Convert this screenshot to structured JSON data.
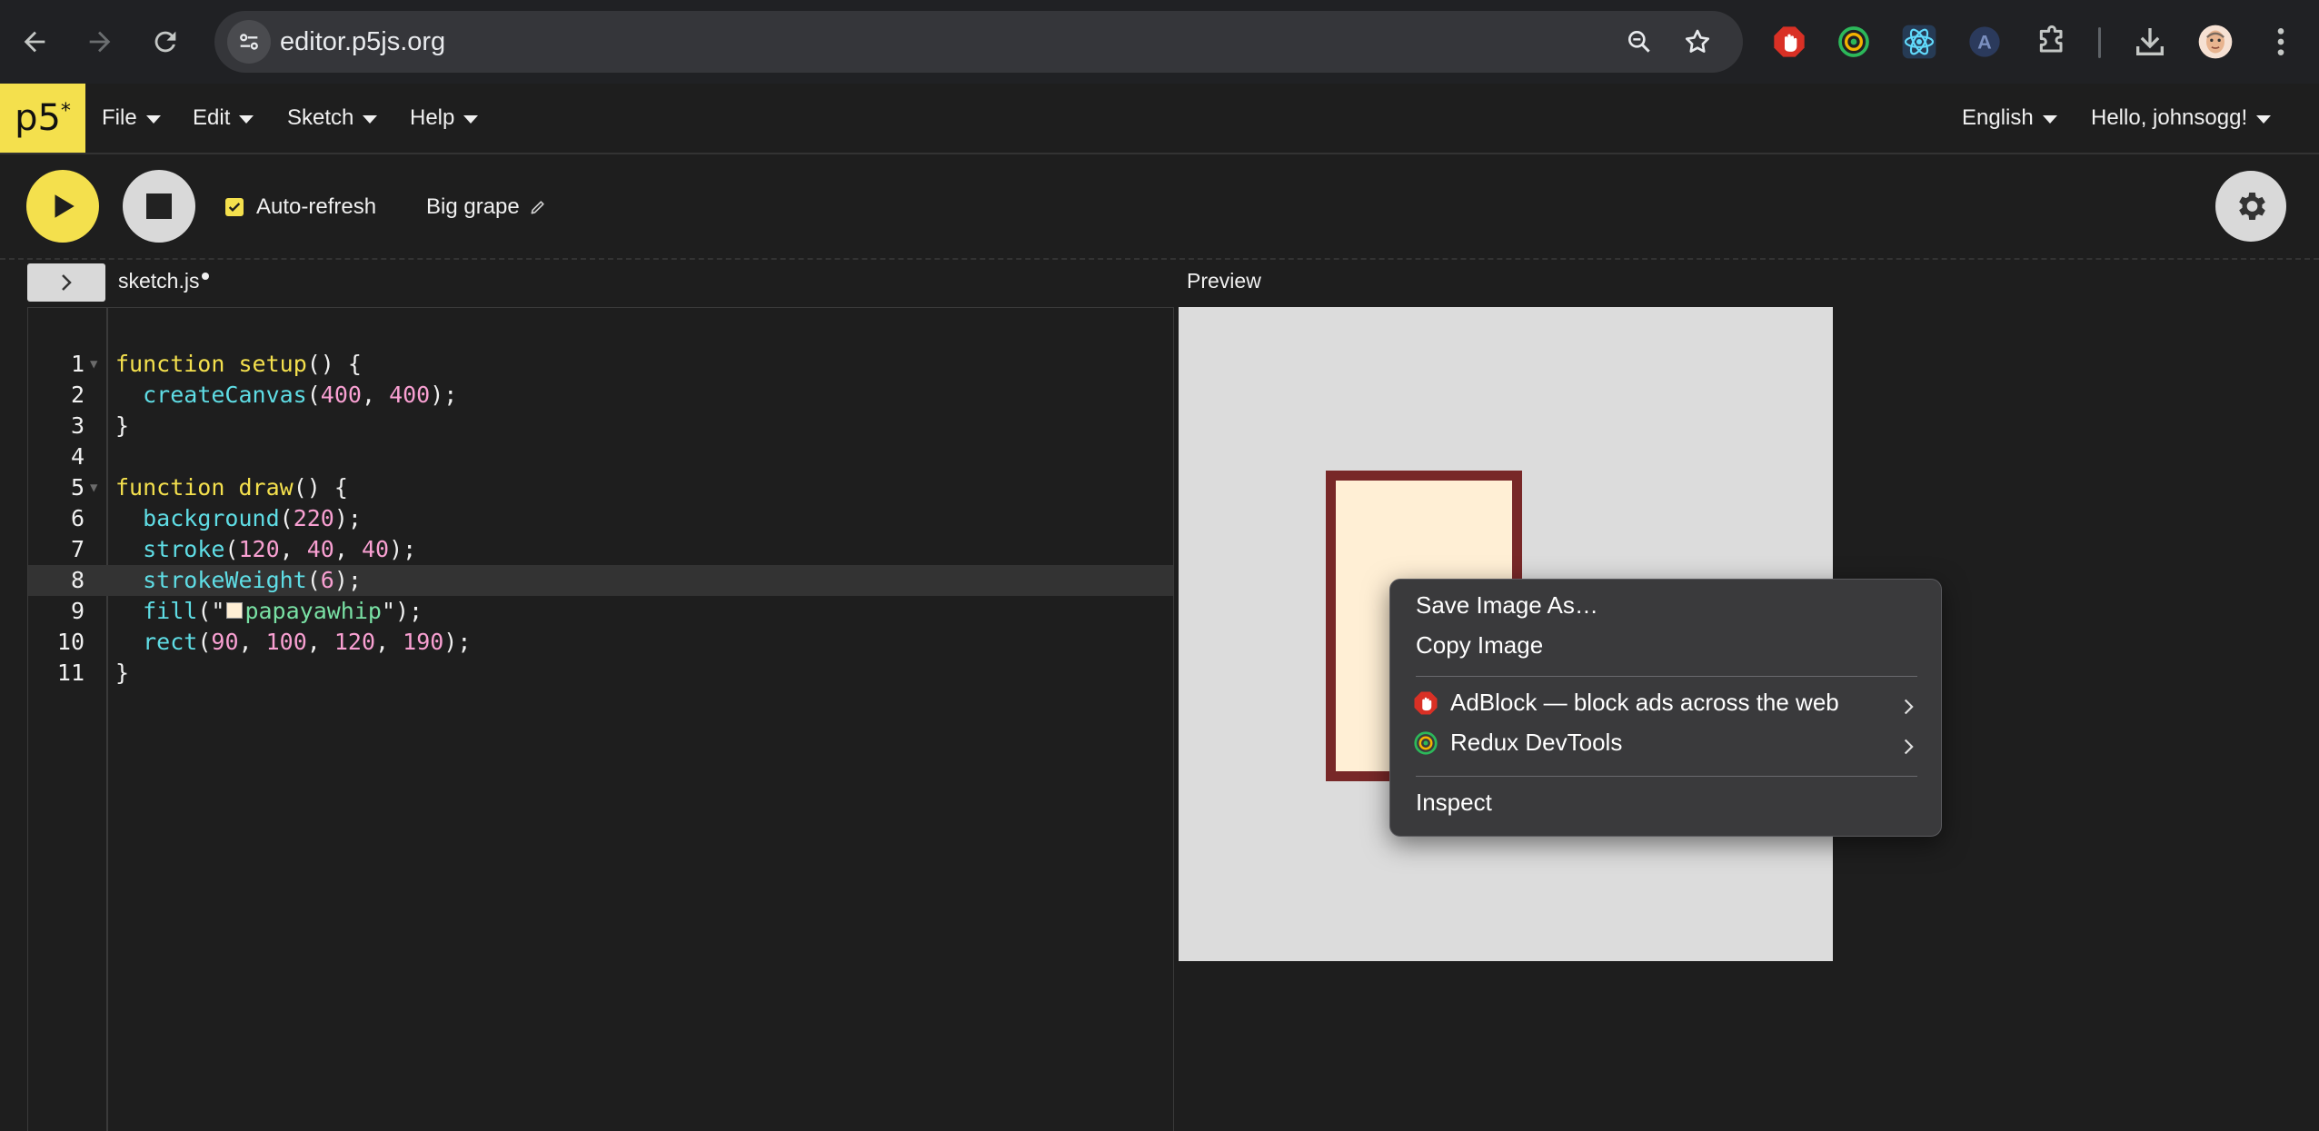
{
  "browser": {
    "url": "editor.p5js.org",
    "icons": [
      "back-icon",
      "forward-icon",
      "reload-icon",
      "site-info-icon",
      "zoom-icon",
      "bookmark-star-icon",
      "adblock-extension-icon",
      "redux-devtools-extension-icon",
      "react-devtools-extension-icon",
      "extension-a-icon",
      "extensions-puzzle-icon",
      "downloads-icon",
      "profile-avatar",
      "more-menu-icon"
    ]
  },
  "p5nav": {
    "logo": "p5",
    "logo_sup": "*",
    "menus": [
      "File",
      "Edit",
      "Sketch",
      "Help"
    ],
    "language": "English",
    "user": "Hello, johnsogg!"
  },
  "toolbar": {
    "auto_refresh_label": "Auto-refresh",
    "auto_refresh_checked": true,
    "sketch_name": "Big grape"
  },
  "editor": {
    "filename": "sketch.js",
    "active_line": 8,
    "lines": [
      {
        "n": "1",
        "fold": true,
        "tokens": [
          {
            "t": "function",
            "c": "kw"
          },
          {
            "t": " "
          },
          {
            "t": "setup",
            "c": "kw"
          },
          {
            "t": "() {"
          }
        ]
      },
      {
        "n": "2",
        "tokens": [
          {
            "t": "  "
          },
          {
            "t": "createCanvas",
            "c": "fn"
          },
          {
            "t": "("
          },
          {
            "t": "400",
            "c": "num"
          },
          {
            "t": ", "
          },
          {
            "t": "400",
            "c": "num"
          },
          {
            "t": ");"
          }
        ]
      },
      {
        "n": "3",
        "tokens": [
          {
            "t": "}"
          }
        ]
      },
      {
        "n": "4",
        "tokens": []
      },
      {
        "n": "5",
        "fold": true,
        "tokens": [
          {
            "t": "function",
            "c": "kw"
          },
          {
            "t": " "
          },
          {
            "t": "draw",
            "c": "kw"
          },
          {
            "t": "() {"
          }
        ]
      },
      {
        "n": "6",
        "tokens": [
          {
            "t": "  "
          },
          {
            "t": "background",
            "c": "fn"
          },
          {
            "t": "("
          },
          {
            "t": "220",
            "c": "num"
          },
          {
            "t": ");"
          }
        ]
      },
      {
        "n": "7",
        "tokens": [
          {
            "t": "  "
          },
          {
            "t": "stroke",
            "c": "fn"
          },
          {
            "t": "("
          },
          {
            "t": "120",
            "c": "num"
          },
          {
            "t": ", "
          },
          {
            "t": "40",
            "c": "num"
          },
          {
            "t": ", "
          },
          {
            "t": "40",
            "c": "num"
          },
          {
            "t": ");"
          }
        ]
      },
      {
        "n": "8",
        "tokens": [
          {
            "t": "  "
          },
          {
            "t": "strokeWeight",
            "c": "fn"
          },
          {
            "t": "("
          },
          {
            "t": "6",
            "c": "num"
          },
          {
            "t": ");"
          }
        ]
      },
      {
        "n": "9",
        "tokens": [
          {
            "t": "  "
          },
          {
            "t": "fill",
            "c": "fn"
          },
          {
            "t": "(\"",
            "c": ""
          },
          {
            "t": "",
            "c": "swatch"
          },
          {
            "t": "papayawhip",
            "c": "str"
          },
          {
            "t": "\");"
          }
        ]
      },
      {
        "n": "10",
        "tokens": [
          {
            "t": "  "
          },
          {
            "t": "rect",
            "c": "fn"
          },
          {
            "t": "("
          },
          {
            "t": "90",
            "c": "num"
          },
          {
            "t": ", "
          },
          {
            "t": "100",
            "c": "num"
          },
          {
            "t": ", "
          },
          {
            "t": "120",
            "c": "num"
          },
          {
            "t": ", "
          },
          {
            "t": "190",
            "c": "num"
          },
          {
            "t": ");"
          }
        ]
      },
      {
        "n": "11",
        "tokens": [
          {
            "t": "}"
          }
        ]
      }
    ]
  },
  "preview": {
    "label": "Preview",
    "background": "#dcdcdc",
    "rect_fill": "#ffefd5",
    "rect_stroke": "#782828"
  },
  "context_menu": {
    "save_image": "Save Image As…",
    "copy_image": "Copy Image",
    "adblock": "AdBlock — block ads across the web",
    "redux": "Redux DevTools",
    "inspect": "Inspect"
  },
  "colors": {
    "accent": "#f4e04d",
    "keyword": "#f4e04d",
    "function": "#5fdde5",
    "number": "#f9a0d2",
    "string": "#79e0a4"
  }
}
